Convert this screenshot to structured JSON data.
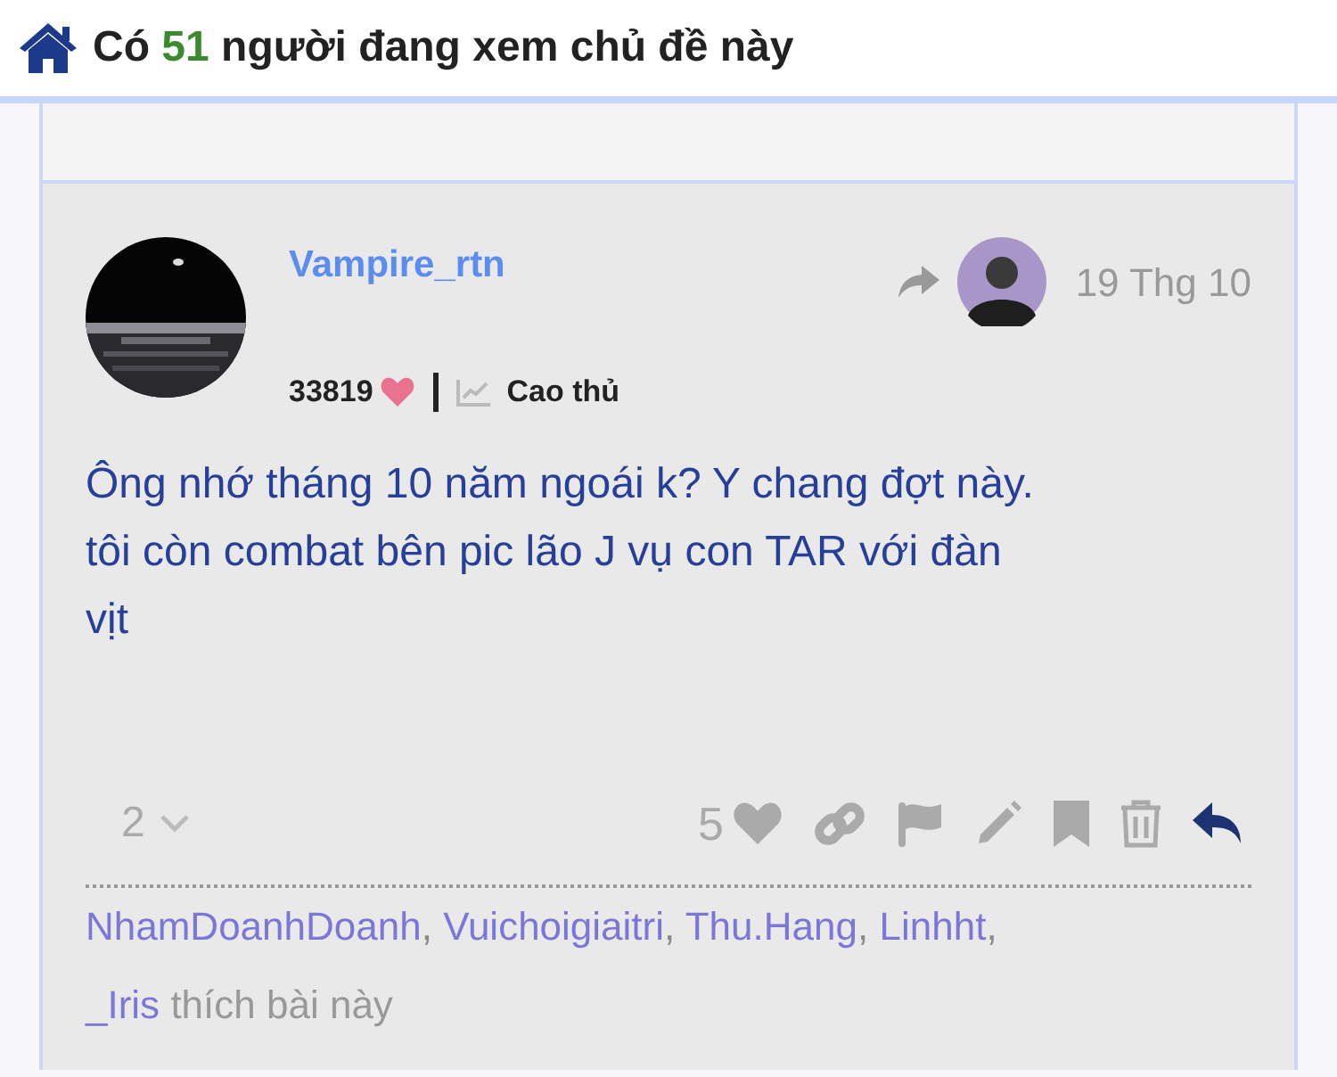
{
  "header": {
    "prefix": "Có",
    "count": "51",
    "suffix": "người đang xem chủ đề này"
  },
  "post": {
    "username": "Vampire_rtn",
    "likes_total": "33819",
    "rank": "Cao thủ",
    "date": "19 Thg 10",
    "body_lines": [
      "Ông nhớ tháng 10 năm ngoái k? Y chang đợt này.",
      "tôi còn combat bên pic lão J vụ con TAR với đàn",
      "vịt"
    ],
    "replies_count": "2",
    "like_count": "5",
    "likers": [
      "NhamDoanhDoanh",
      "Vuichoigiaitri",
      "Thu.Hang",
      "Linhht",
      "_Iris"
    ],
    "separator": ",",
    "liked_text": "thích bài này"
  }
}
